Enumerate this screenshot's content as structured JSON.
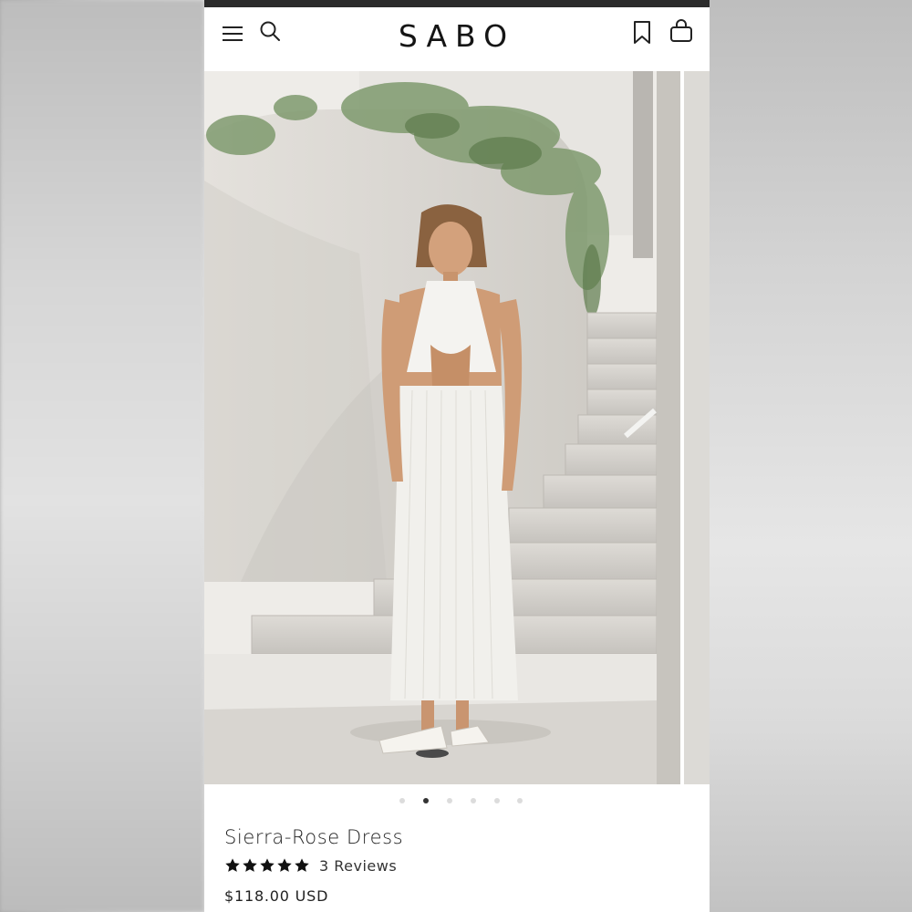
{
  "header": {
    "brand": "SABO",
    "icons": [
      "menu-icon",
      "search-icon",
      "bookmark-icon",
      "shopping-bag-icon"
    ]
  },
  "gallery": {
    "image_count": 6,
    "active_index": 1
  },
  "product": {
    "title": "Sierra-Rose Dress",
    "rating": 5,
    "max_rating": 5,
    "reviews_label": "3 Reviews",
    "price": "$118.00 USD"
  },
  "colors": {
    "brand_text": "#151515",
    "star": "#111111",
    "dot_active": "#333333",
    "dot_inactive": "#dcdcdc"
  }
}
